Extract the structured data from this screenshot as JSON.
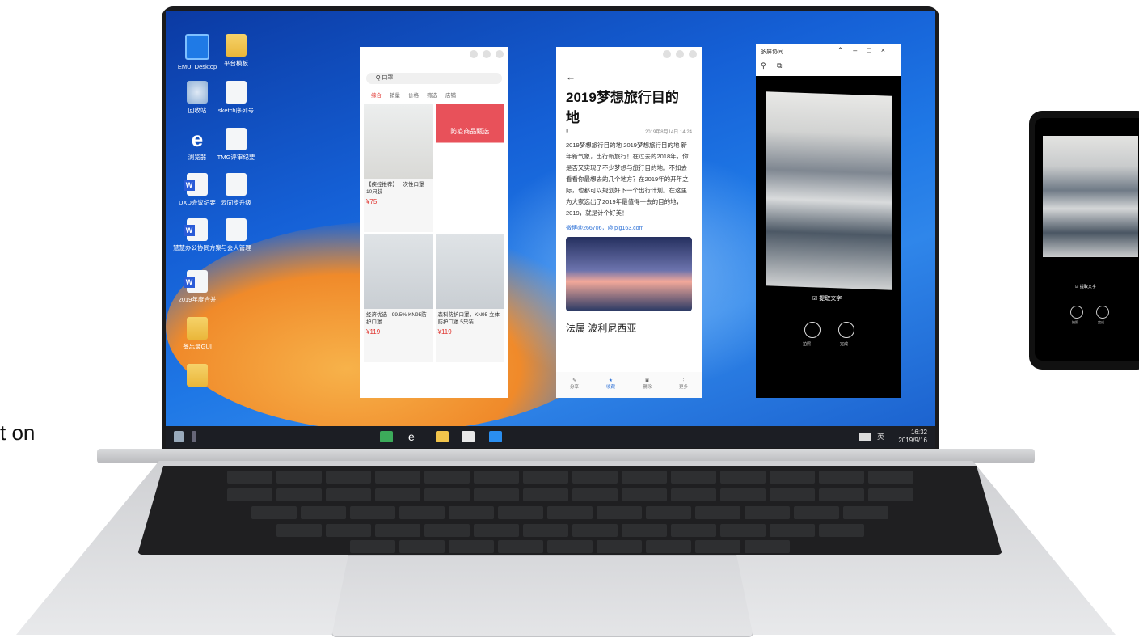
{
  "side_text": "t on",
  "desktop_icons": [
    {
      "name": "emui-desktop",
      "label": "EMUI Desktop",
      "icon": "emui-icon",
      "kind": "blue"
    },
    {
      "name": "folder-1",
      "label": "平台模板",
      "icon": "folder-icon",
      "kind": "folder"
    },
    {
      "name": "recycle-bin",
      "label": "回收站",
      "icon": "recycle-bin-icon",
      "kind": "bin"
    },
    {
      "name": "sketch-doc",
      "label": "sketch序列号",
      "icon": "document-icon",
      "kind": "doc"
    },
    {
      "name": "browser",
      "label": "浏览器",
      "icon": "edge-icon",
      "kind": "edge"
    },
    {
      "name": "tmg-doc",
      "label": "TMG评审纪要",
      "icon": "document-icon",
      "kind": "doc"
    },
    {
      "name": "uxd-doc",
      "label": "UXD会议纪要",
      "icon": "word-icon",
      "kind": "word"
    },
    {
      "name": "cloud-doc",
      "label": "云同步升级",
      "icon": "document-icon",
      "kind": "doc"
    },
    {
      "name": "office-doc",
      "label": "慧慧办公协同方案",
      "icon": "word-icon",
      "kind": "word"
    },
    {
      "name": "manage-doc",
      "label": "与会人管理",
      "icon": "document-icon",
      "kind": "doc"
    },
    {
      "name": "year-doc",
      "label": "2019年度合并",
      "icon": "word-icon",
      "kind": "word"
    },
    {
      "name": "gui-folder",
      "label": "备忘录GUI",
      "icon": "folder-icon",
      "kind": "folder"
    },
    {
      "name": "folder-3",
      "label": "",
      "icon": "folder-icon",
      "kind": "folder"
    }
  ],
  "taskbar": {
    "time": "16:32",
    "date": "2019/9/16",
    "lang": "英",
    "apps": [
      "multi-screen-icon",
      "edge-icon",
      "file-explorer-icon",
      "store-icon",
      "emui-icon"
    ]
  },
  "shop_window": {
    "search": "Q 口罩",
    "tabs": [
      "综合",
      "销量",
      "价格",
      "筛选",
      "店铺"
    ],
    "promo": "防疫商品甄选",
    "cards": [
      {
        "text": "【疾控推荐】一次性口罩 10只装",
        "price": "¥75"
      },
      {
        "text": "",
        "price": ""
      },
      {
        "text": "经济优选 - 99.5% KN95防护口罩",
        "price": "¥119"
      },
      {
        "text": "森科防护口罩，KN95 立体防护口罩 5只装",
        "price": "¥119"
      }
    ]
  },
  "article_window": {
    "title": "2019梦想旅行目的地",
    "date": "2019年8月14日 14:24",
    "body": "2019梦想旅行目的地 2019梦想旅行目的地 新年新气象，出行新旅行！在过去的2018年，你是否又实现了不少梦想与旅行目的地。不如去看看你最想去的几个地方？在2019年的开年之际，也都可以规划好下一个出行计划。在这里为大家选出了2019年最值得一去的目的地，2019，就是计个好美！",
    "link": "微博@266706，@ipig163.com",
    "subheading": "法属 波利尼西亚",
    "nav": [
      "分享",
      "收藏",
      "删除",
      "更多"
    ]
  },
  "camera_window": {
    "title": "多屏协同",
    "checkbox_label": "提取文字",
    "buttons": [
      "拍照",
      "完成"
    ]
  },
  "phone": {
    "checkbox_label": "提取文字",
    "buttons": [
      "拍照",
      "完成"
    ]
  }
}
